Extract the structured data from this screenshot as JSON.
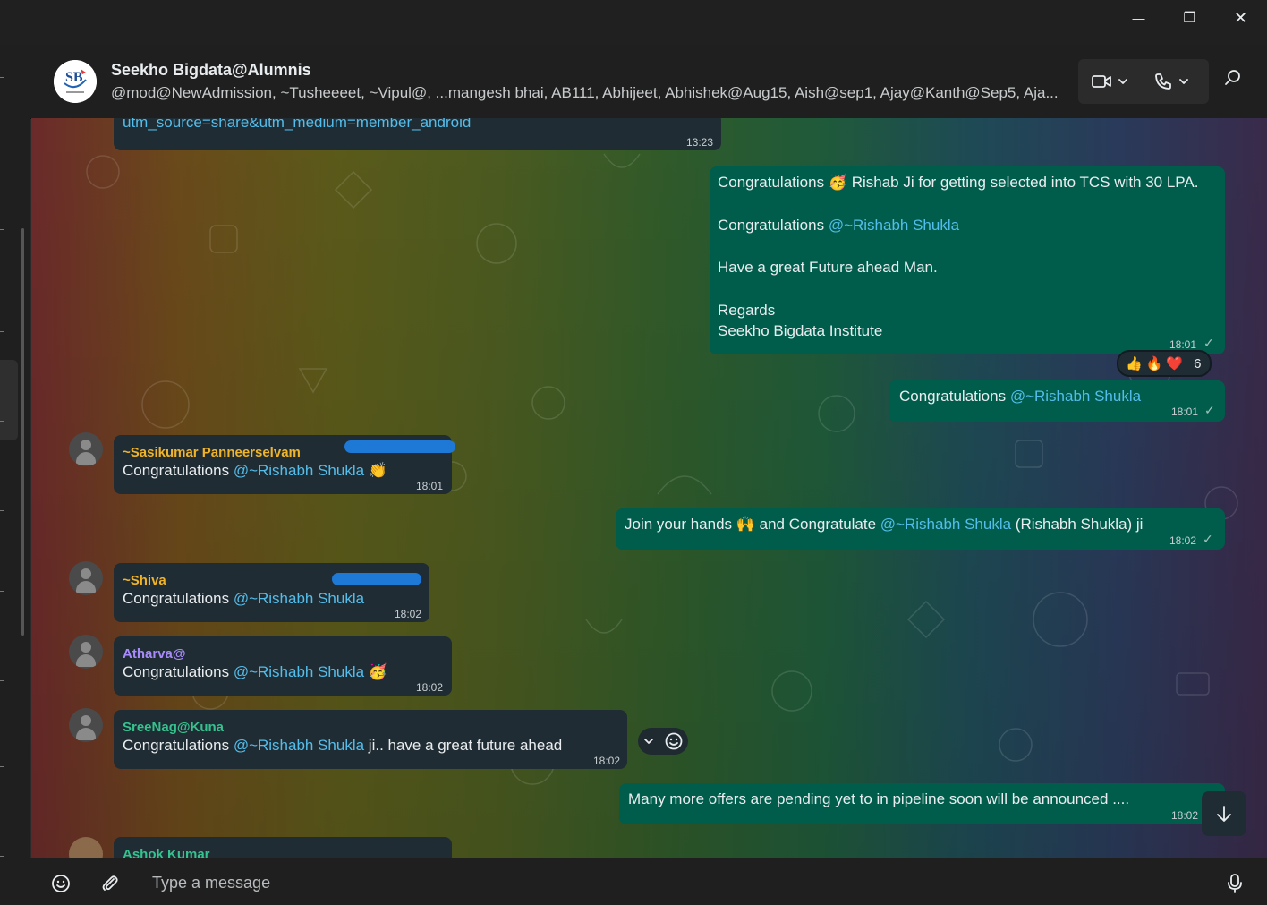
{
  "window": {
    "minimize_glyph": "—",
    "restore_glyph": "❐",
    "close_glyph": "✕"
  },
  "header": {
    "group_name": "Seekho Bigdata@Alumnis",
    "members": "@mod@NewAdmission, ~Tusheeeet, ~Vipul@, ...mangesh bhai, AB111, Abhijeet, Abhishek@Aug15, Aish@sep1, Ajay@Kanth@Sep5, Aja...",
    "logo_text": "SB"
  },
  "messages": [
    {
      "text": "utm_source=share&utm_medium=member_android",
      "time": "13:23"
    },
    {
      "line1_pre": "Congratulations ",
      "line1_emoji": "🥳",
      "line1_post": " Rishab Ji for getting selected into TCS with 30 LPA.",
      "line2_pre": "Congratulations ",
      "line2_mention": "@~Rishabh Shukla",
      "line3": "Have a great Future ahead Man.",
      "line4": "Regards",
      "line5": "Seekho Bigdata Institute",
      "time": "18:01",
      "check": "✓",
      "reactions": [
        "👍",
        "🔥",
        "❤️"
      ],
      "reaction_count": "6"
    },
    {
      "pre": "Congratulations ",
      "mention": "@~Rishabh Shukla",
      "time": "18:01",
      "check": "✓"
    },
    {
      "sender": "~Sasikumar Panneerselvam",
      "pre": "Congratulations ",
      "mention": "@~Rishabh Shukla",
      "post": " 👏",
      "time": "18:01"
    },
    {
      "pre": "Join your hands 🙌 and Congratulate ",
      "mention": "@~Rishabh Shukla",
      "post": " (Rishabh Shukla) ji",
      "time": "18:02",
      "check": "✓"
    },
    {
      "sender": "~Shiva",
      "pre": "Congratulations ",
      "mention": "@~Rishabh Shukla",
      "time": "18:02"
    },
    {
      "sender": "Atharva@",
      "pre": "Congratulations ",
      "mention": "@~Rishabh Shukla",
      "post": " 🥳",
      "time": "18:02"
    },
    {
      "sender": "SreeNag@Kuna",
      "pre": "Congratulations ",
      "mention": "@~Rishabh Shukla",
      "post": " ji.. have a great future ahead",
      "time": "18:02"
    },
    {
      "text": "Many more offers are pending yet to in pipeline soon will be announced ....",
      "time": "18:02"
    },
    {
      "sender": "Ashok Kumar"
    }
  ],
  "sender_colors": {
    "sasikumar": "#f0b429",
    "shiva": "#f0b429",
    "atharva": "#a78bfa",
    "sreenag": "#35c28f",
    "ashok": "#35c28f"
  },
  "composer": {
    "placeholder": "Type a message"
  }
}
